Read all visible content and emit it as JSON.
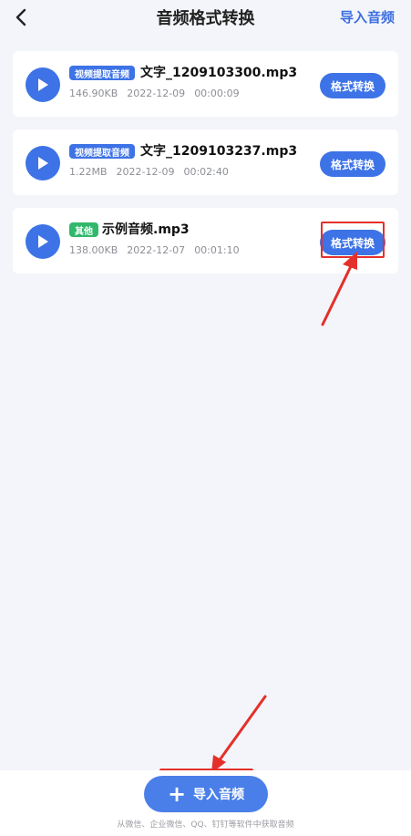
{
  "header": {
    "title": "音频格式转换",
    "import_label": "导入音频"
  },
  "files": [
    {
      "tag": "视频提取音频",
      "tag_color": "#3d73e6",
      "name": "文字_1209103300.mp3",
      "size": "146.90KB",
      "date": "2022-12-09",
      "duration": "00:00:09",
      "action": "格式转换"
    },
    {
      "tag": "视频提取音频",
      "tag_color": "#3d73e6",
      "name": "文字_1209103237.mp3",
      "size": "1.22MB",
      "date": "2022-12-09",
      "duration": "00:02:40",
      "action": "格式转换"
    },
    {
      "tag": "其他",
      "tag_color": "#31b86b",
      "name": "示例音频.mp3",
      "size": "138.00KB",
      "date": "2022-12-07",
      "duration": "00:01:10",
      "action": "格式转换"
    }
  ],
  "bottom": {
    "import_label": "导入音频",
    "hint": "从微信、企业微信、QQ、钉钉等软件中获取音频"
  },
  "colors": {
    "accent": "#3d73e6",
    "annotation": "#e4302a"
  }
}
